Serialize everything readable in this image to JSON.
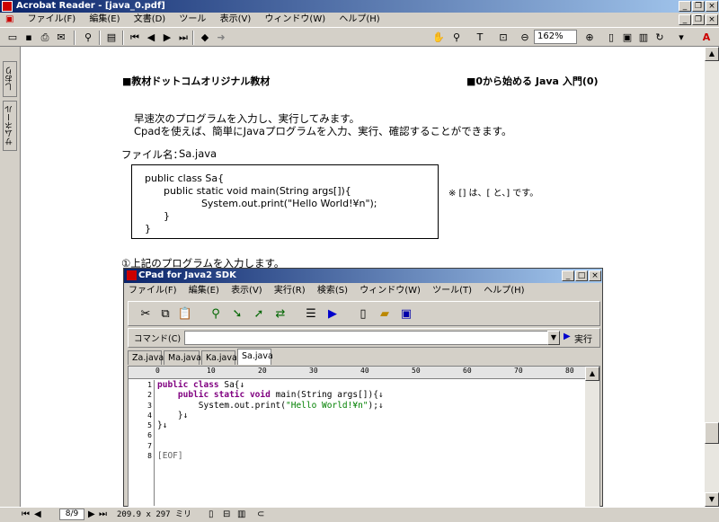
{
  "app": {
    "title": "Acrobat Reader - [java_0.pdf]",
    "menu": [
      "ファイル(F)",
      "編集(E)",
      "文書(D)",
      "ツール",
      "表示(V)",
      "ウィンドウ(W)",
      "ヘルプ(H)"
    ],
    "zoom": "162%",
    "left_tabs": [
      "しおり",
      "サムネール"
    ]
  },
  "status": {
    "page": "8/9",
    "size": "209.9 x 297 ミリ"
  },
  "doc": {
    "header_left": "■教材ドットコムオリジナル教材",
    "header_right": "■0から始める Java 入門(0)",
    "intro_1": "早速次のプログラムを入力し、実行してみます。",
    "intro_2": "Cpadを使えば、簡単にJavaプログラムを入力、実行、確認することができます。",
    "file_label": "ファイル名：",
    "file_name": "Sa.java",
    "code_lines": [
      "public class Sa{",
      "      public static void main(String args[]){",
      "                  System.out.print(\"Hello World!¥n\");",
      "      }",
      "}"
    ],
    "note": "※ [] は、[ と、] です。",
    "step": "①上記のプログラムを入力します。"
  },
  "cpad": {
    "title": "CPad for Java2 SDK",
    "menu": [
      "ファイル(F)",
      "編集(E)",
      "表示(V)",
      "実行(R)",
      "検索(S)",
      "ウィンドウ(W)",
      "ツール(T)",
      "ヘルプ(H)"
    ],
    "command_label": "コマンド(C)",
    "run_label": "実行",
    "tabs": [
      "Za.java",
      "Ma.java",
      "Ka.java",
      "Sa.java"
    ],
    "active_tab": "Sa.java",
    "ruler": [
      "0",
      "10",
      "20",
      "30",
      "40",
      "50",
      "60",
      "70",
      "80"
    ],
    "line_numbers": [
      "1",
      "2",
      "3",
      "4",
      "5",
      "6",
      "7",
      "8"
    ],
    "eof": "[EOF]",
    "code": {
      "l1a": "public class",
      "l1b": " Sa{↓",
      "l2a": "    public static void",
      "l2b": " main(String args[]){↓",
      "l3a": "        System.out.print(",
      "l3s": "\"Hello World!¥n\"",
      "l3b": ");↓",
      "l4": "    }↓",
      "l5": "}↓"
    }
  }
}
